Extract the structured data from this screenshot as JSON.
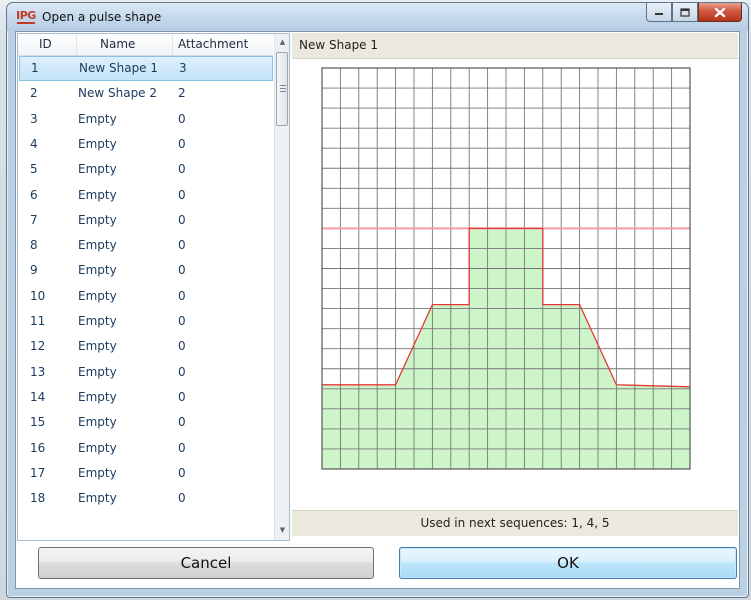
{
  "window": {
    "title": "Open a pulse shape"
  },
  "list": {
    "headers": {
      "id": "ID",
      "name": "Name",
      "attachment": "Attachment"
    },
    "selected_index": 0,
    "rows": [
      {
        "id": "1",
        "name": "New Shape 1",
        "attachment": "3"
      },
      {
        "id": "2",
        "name": "New Shape 2",
        "attachment": "2"
      },
      {
        "id": "3",
        "name": "Empty",
        "attachment": "0"
      },
      {
        "id": "4",
        "name": "Empty",
        "attachment": "0"
      },
      {
        "id": "5",
        "name": "Empty",
        "attachment": "0"
      },
      {
        "id": "6",
        "name": "Empty",
        "attachment": "0"
      },
      {
        "id": "7",
        "name": "Empty",
        "attachment": "0"
      },
      {
        "id": "8",
        "name": "Empty",
        "attachment": "0"
      },
      {
        "id": "9",
        "name": "Empty",
        "attachment": "0"
      },
      {
        "id": "10",
        "name": "Empty",
        "attachment": "0"
      },
      {
        "id": "11",
        "name": "Empty",
        "attachment": "0"
      },
      {
        "id": "12",
        "name": "Empty",
        "attachment": "0"
      },
      {
        "id": "13",
        "name": "Empty",
        "attachment": "0"
      },
      {
        "id": "14",
        "name": "Empty",
        "attachment": "0"
      },
      {
        "id": "15",
        "name": "Empty",
        "attachment": "0"
      },
      {
        "id": "16",
        "name": "Empty",
        "attachment": "0"
      },
      {
        "id": "17",
        "name": "Empty",
        "attachment": "0"
      },
      {
        "id": "18",
        "name": "Empty",
        "attachment": "0"
      }
    ]
  },
  "preview": {
    "shape_name": "New Shape 1",
    "usage_text": "Used in next sequences: 1, 4, 5"
  },
  "chart_data": {
    "type": "area",
    "grid": true,
    "grid_cols": 20,
    "grid_rows": 20,
    "xlim": [
      0,
      20
    ],
    "ylim": [
      0,
      20
    ],
    "reference_line_y": 12,
    "x": [
      0,
      4,
      6,
      8,
      8,
      12,
      12,
      14,
      16,
      20
    ],
    "y": [
      4.2,
      4.2,
      8.2,
      8.2,
      12,
      12,
      8.2,
      8.2,
      4.2,
      4.1
    ],
    "colors": {
      "fill": "#cdf5c9",
      "line": "#e53935",
      "reference": "#f39aa2",
      "grid": "#777777"
    }
  },
  "buttons": {
    "cancel": "Cancel",
    "ok": "OK"
  },
  "icons": {
    "logo": "ipg-logo",
    "minimize": "minimize-icon",
    "maximize": "maximize-icon",
    "close": "close-icon"
  }
}
